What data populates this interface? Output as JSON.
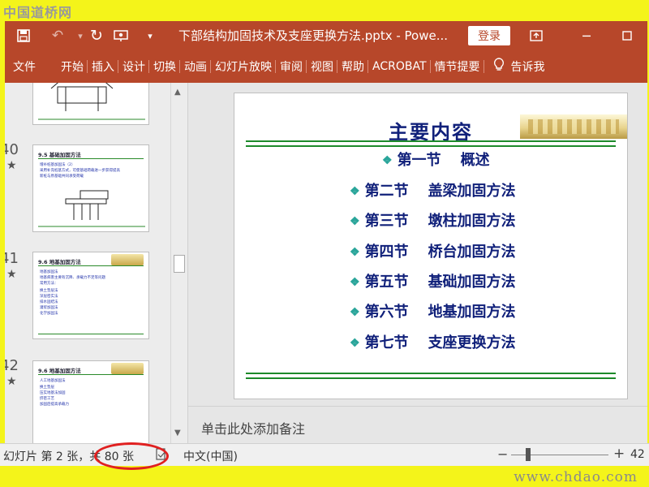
{
  "watermark": {
    "top": "中国道桥网",
    "bottom": "www.chdao.com"
  },
  "titlebar": {
    "save_icon": "save-icon",
    "undo_icon": "undo-icon",
    "redo_icon": "repeat-icon",
    "present_icon": "present-from-start-icon",
    "customize_icon": "chevron-down-icon",
    "doc_title": "下部结构加固技术及支座更换方法.pptx - Powe...",
    "login_label": "登录",
    "ribbon_options_icon": "ribbon-display-icon",
    "minimize_icon": "minimize-icon",
    "maximize_icon": "maximize-icon"
  },
  "ribbon": {
    "tabs": [
      "文件",
      "开始",
      "插入",
      "设计",
      "切换",
      "动画",
      "幻灯片放映",
      "审阅",
      "视图",
      "帮助",
      "ACROBAT",
      "情节提要"
    ],
    "tell_me_icon": "lightbulb-icon",
    "tell_me_label": "告诉我"
  },
  "thumbnails": [
    {
      "num": "",
      "title": "",
      "bullets": []
    },
    {
      "num": "40",
      "title": "9.5 基础加固方法",
      "bullets": [
        "增补桩基加固法（2）",
        "采用补充桩基方式，可使基础荷载进一步获得提高",
        "新桩与原基础共同承受荷载"
      ]
    },
    {
      "num": "41",
      "title": "9.6 地基加固方法",
      "bullets": [
        "地基加固法",
        "地基病害主要有沉降、承载力不足等问题",
        "常用方法：",
        "换土垫层法",
        "深层密实法",
        "排水固结法",
        "灌浆加固法",
        "化学加固法"
      ]
    },
    {
      "num": "42",
      "title": "9.6 地基加固方法",
      "bullets": [
        "人工地基加固法",
        "换土垫层",
        "压实地基法加固",
        "挤密工艺",
        "加固后提高承载力"
      ]
    }
  ],
  "slide": {
    "title": "主要内容",
    "items": [
      {
        "section": "第一节",
        "topic": "概述"
      },
      {
        "section": "第二节",
        "topic": "盖梁加固方法"
      },
      {
        "section": "第三节",
        "topic": "墩柱加固方法"
      },
      {
        "section": "第四节",
        "topic": "桥台加固方法"
      },
      {
        "section": "第五节",
        "topic": "基础加固方法"
      },
      {
        "section": "第六节",
        "topic": "地基加固方法"
      },
      {
        "section": "第七节",
        "topic": "支座更换方法"
      }
    ]
  },
  "notes": {
    "placeholder": "单击此处添加备注"
  },
  "status": {
    "slide_info": "幻灯片 第 2 张，共 80 张",
    "spell_icon": "spellcheck-icon",
    "language": "中文(中国)",
    "zoom_percent": "42"
  },
  "colors": {
    "accent": "#b7472a",
    "slide_title": "#10207a",
    "rule": "#1d8a2a",
    "highlight": "#e02020"
  }
}
